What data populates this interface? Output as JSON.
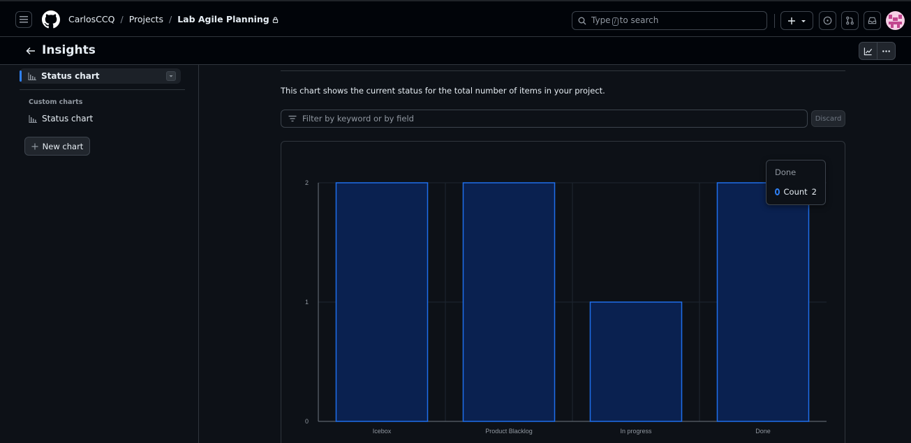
{
  "header": {
    "breadcrumbs": [
      "CarlosCCQ",
      "Projects",
      "Lab Agile Planning"
    ],
    "search_prefix": "Type",
    "search_key": "/",
    "search_suffix": "to search"
  },
  "subheader": {
    "title": "Insights"
  },
  "sidebar": {
    "active_item": "Status chart",
    "custom_heading": "Custom charts",
    "custom_items": [
      "Status chart"
    ],
    "new_chart_label": "New chart"
  },
  "main": {
    "description": "This chart shows the current status for the total number of items in your project.",
    "filter_placeholder": "Filter by keyword or by field",
    "discard_label": "Discard"
  },
  "tooltip": {
    "title": "Done",
    "series_label": "Count",
    "value": "2"
  },
  "colors": {
    "accent": "#2f81f7",
    "bar_fill": "#0a2150",
    "bar_stroke": "#1f6feb"
  },
  "chart_data": {
    "type": "bar",
    "categories": [
      "Icebox",
      "Product Blacklog",
      "In progress",
      "Done"
    ],
    "series": [
      {
        "name": "Count",
        "values": [
          2,
          2,
          1,
          2
        ]
      }
    ],
    "ylim": [
      0,
      2
    ],
    "yticks": [
      0,
      1,
      2
    ],
    "grid": true
  }
}
